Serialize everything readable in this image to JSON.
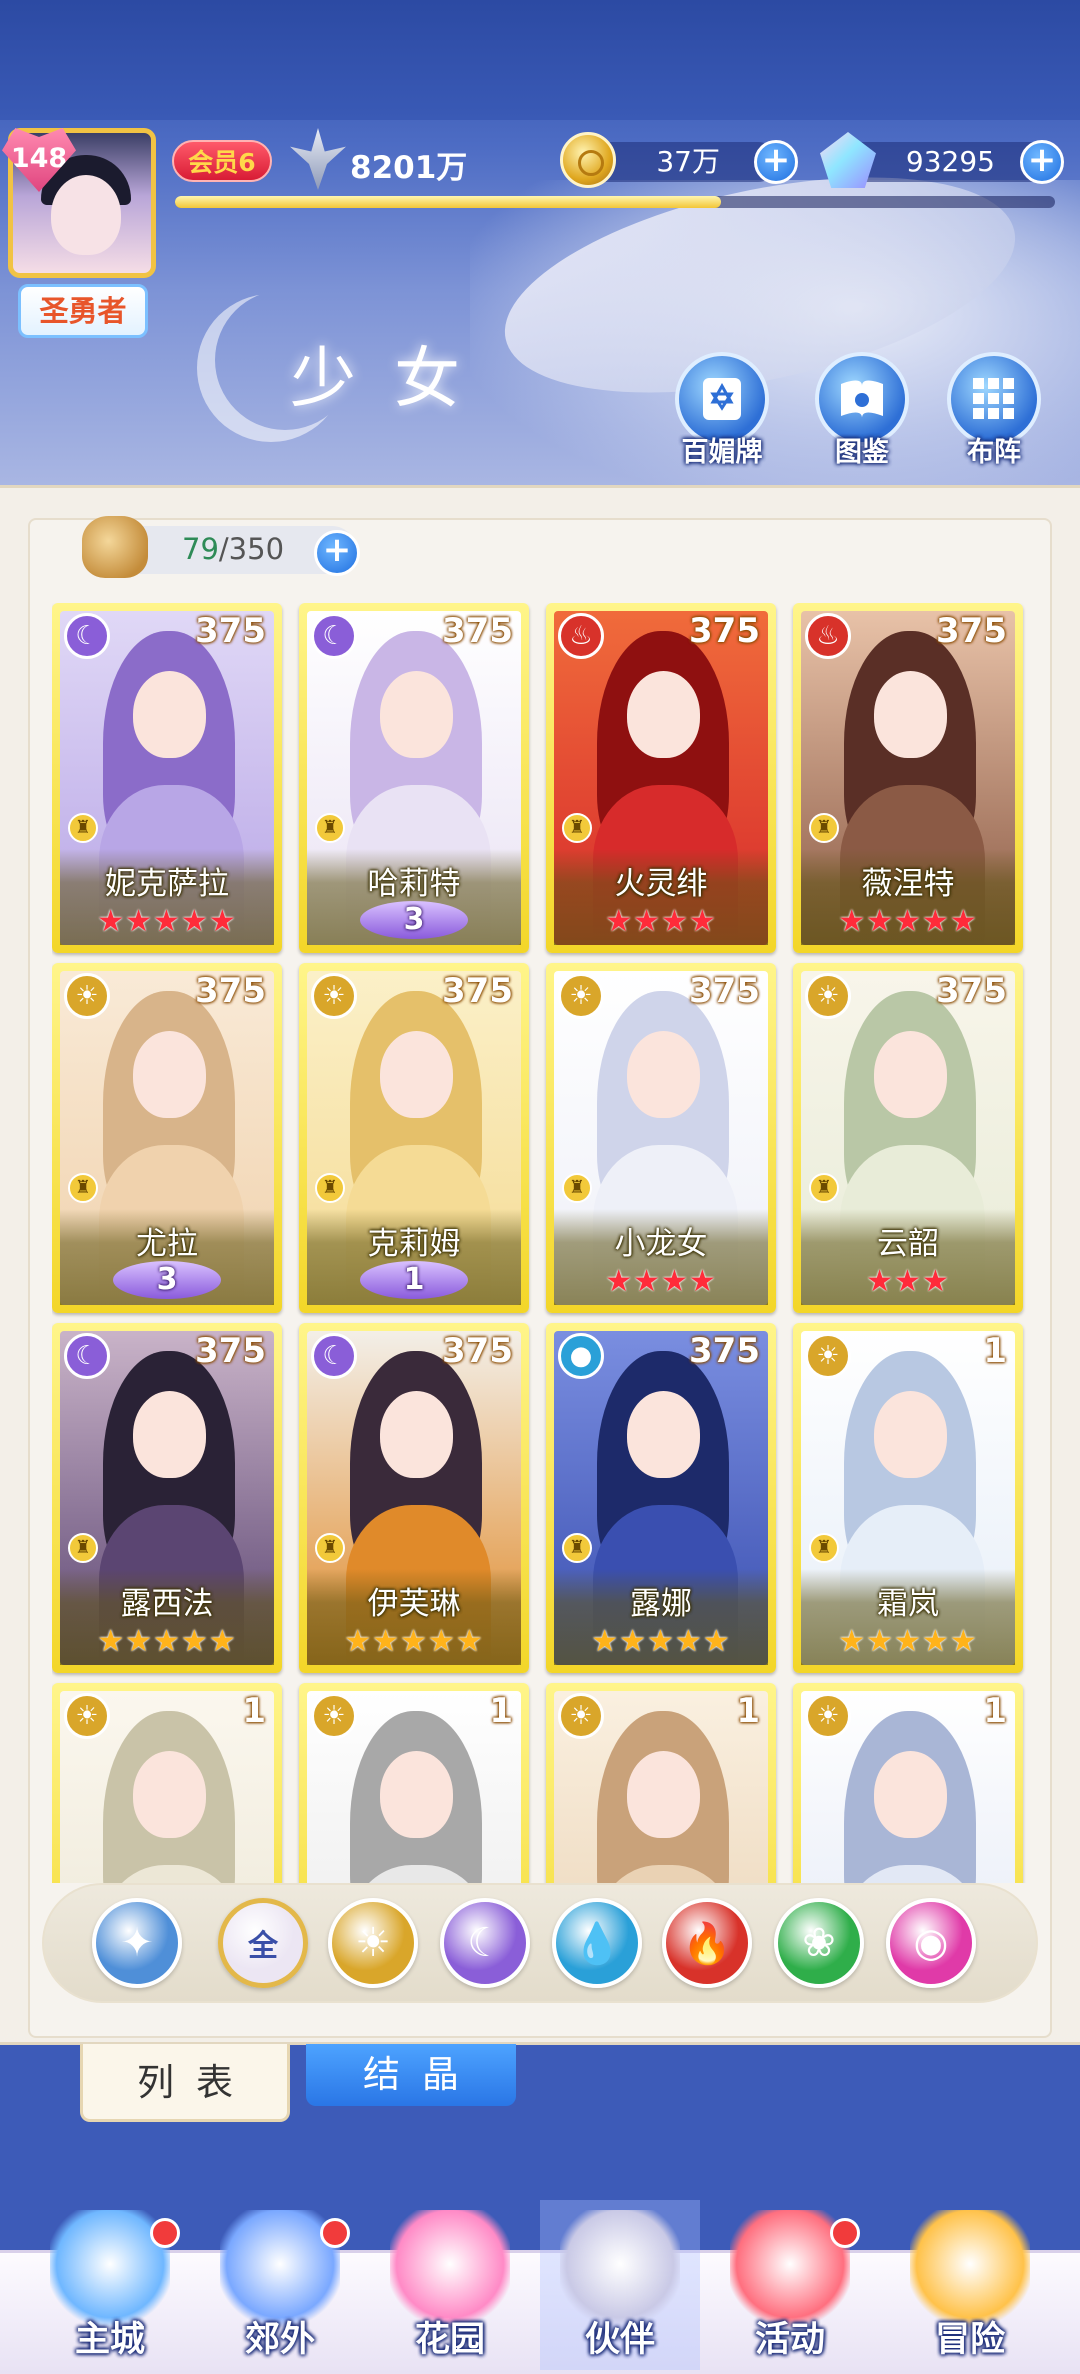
{
  "header": {
    "player_level": "148",
    "player_title": "圣勇者",
    "vip_label": "会员6",
    "power": "8201万",
    "gold": "37万",
    "gems": "93295",
    "exp_progress": 0.62
  },
  "page": {
    "title": "少女",
    "menu": [
      {
        "label": "百媚牌",
        "icon": "card-icon"
      },
      {
        "label": "图鉴",
        "icon": "book-icon"
      },
      {
        "label": "布阵",
        "icon": "formation-grid-icon"
      }
    ]
  },
  "capacity": {
    "current": "79",
    "separator_total": "/350"
  },
  "cards": [
    {
      "name": "妮克萨拉",
      "level": "375",
      "element": "moon",
      "stars": "★★★★★",
      "star_color": "red",
      "wing": "",
      "palette": [
        "#8b6cc9",
        "#b8a6e6",
        "#e0d8f6"
      ]
    },
    {
      "name": "哈莉特",
      "level": "375",
      "element": "moon",
      "stars": "",
      "star_color": "",
      "wing": "3",
      "palette": [
        "#c9b6e6",
        "#e9e2f4",
        "#ffffff"
      ]
    },
    {
      "name": "火灵绯",
      "level": "375",
      "element": "fire",
      "stars": "★★★★",
      "star_color": "red",
      "wing": "",
      "palette": [
        "#8f1010",
        "#d72b2b",
        "#f06b3b"
      ]
    },
    {
      "name": "薇涅特",
      "level": "375",
      "element": "fire",
      "stars": "★★★★★",
      "star_color": "red",
      "wing": "",
      "palette": [
        "#5a2f26",
        "#8b5a45",
        "#e8c2a8"
      ]
    },
    {
      "name": "尤拉",
      "level": "375",
      "element": "sun",
      "stars": "",
      "star_color": "",
      "wing": "3",
      "palette": [
        "#d8b48a",
        "#f0d2ad",
        "#f9ead7"
      ]
    },
    {
      "name": "克莉姆",
      "level": "375",
      "element": "sun",
      "stars": "",
      "star_color": "",
      "wing": "1",
      "palette": [
        "#e5c06a",
        "#f5db95",
        "#fbf0c8"
      ]
    },
    {
      "name": "小龙女",
      "level": "375",
      "element": "sun",
      "stars": "★★★★",
      "star_color": "red",
      "wing": "",
      "palette": [
        "#cfd4ea",
        "#eef0f8",
        "#ffffff"
      ]
    },
    {
      "name": "云韶",
      "level": "375",
      "element": "sun",
      "stars": "★★★",
      "star_color": "red",
      "wing": "",
      "palette": [
        "#b9c7a6",
        "#e8ecd8",
        "#f8f5ea"
      ]
    },
    {
      "name": "露西法",
      "level": "375",
      "element": "moon",
      "stars": "★★★★★",
      "star_color": "gold",
      "wing": "",
      "palette": [
        "#2a2236",
        "#5b4572",
        "#c9b3c8"
      ]
    },
    {
      "name": "伊芙琳",
      "level": "375",
      "element": "moon",
      "stars": "★★★★★",
      "star_color": "gold",
      "wing": "",
      "palette": [
        "#3a2a3a",
        "#e08a2a",
        "#f3efe8"
      ]
    },
    {
      "name": "露娜",
      "level": "375",
      "element": "water",
      "stars": "★★★★★",
      "star_color": "gold",
      "wing": "",
      "palette": [
        "#1d2a6a",
        "#3a4fb0",
        "#7a8ee0"
      ]
    },
    {
      "name": "霜岚",
      "level": "1",
      "element": "sun",
      "stars": "★★★★★",
      "star_color": "gold",
      "wing": "",
      "palette": [
        "#b8c8e2",
        "#e6eef8",
        "#ffffff"
      ]
    },
    {
      "name": "",
      "level": "1",
      "element": "sun",
      "stars": "",
      "star_color": "",
      "wing": "",
      "palette": [
        "#c9c3a8",
        "#ece7d6",
        "#fbf7ee"
      ]
    },
    {
      "name": "",
      "level": "1",
      "element": "sun",
      "stars": "",
      "star_color": "",
      "wing": "",
      "palette": [
        "#a8a8a8",
        "#e8e8e8",
        "#ffffff"
      ]
    },
    {
      "name": "",
      "level": "1",
      "element": "sun",
      "stars": "",
      "star_color": "",
      "wing": "",
      "palette": [
        "#c9a27a",
        "#ead2b4",
        "#faf0e0"
      ]
    },
    {
      "name": "",
      "level": "1",
      "element": "sun",
      "stars": "",
      "star_color": "",
      "wing": "",
      "palette": [
        "#a9b6d6",
        "#e2e8f5",
        "#ffffff"
      ]
    }
  ],
  "filters": [
    {
      "name": "filter-wind",
      "label": "",
      "color": "#4f8fd8",
      "glyph": "✦"
    },
    {
      "name": "filter-all",
      "label": "全",
      "color": "#ece6f3",
      "glyph": "全"
    },
    {
      "name": "filter-sun",
      "label": "",
      "color": "#d9a62a",
      "glyph": "☀"
    },
    {
      "name": "filter-moon",
      "label": "",
      "color": "#8a5ed8",
      "glyph": "☾"
    },
    {
      "name": "filter-water",
      "label": "",
      "color": "#2aa0d8",
      "glyph": "💧"
    },
    {
      "name": "filter-fire",
      "label": "",
      "color": "#d8322a",
      "glyph": "🔥"
    },
    {
      "name": "filter-wood",
      "label": "",
      "color": "#2fae4a",
      "glyph": "❀"
    },
    {
      "name": "filter-spirit",
      "label": "",
      "color": "#e03aa8",
      "glyph": "◉"
    }
  ],
  "tabs": {
    "list": "列表",
    "crystal": "结晶"
  },
  "nav": [
    {
      "label": "主城",
      "icon": "castle-icon",
      "dot": true
    },
    {
      "label": "郊外",
      "icon": "gate-icon",
      "dot": true
    },
    {
      "label": "花园",
      "icon": "heart-garden-icon",
      "dot": false
    },
    {
      "label": "伙伴",
      "icon": "partner-avatar-icon",
      "dot": false
    },
    {
      "label": "活动",
      "icon": "gift-icon",
      "dot": true
    },
    {
      "label": "冒险",
      "icon": "compass-icon",
      "dot": false
    }
  ],
  "colors": {
    "card_gold": "#f3d628",
    "accent_blue": "#2a76e6",
    "star_red": "#ff2b3a",
    "star_gold": "#ffb31a"
  }
}
